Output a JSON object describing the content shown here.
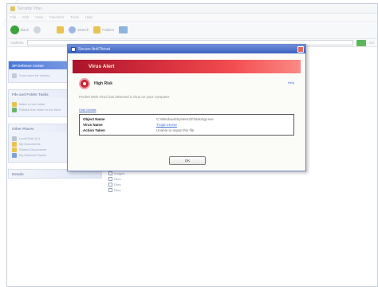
{
  "explorer": {
    "title": "Security Virus",
    "menu": [
      "File",
      "Edit",
      "View",
      "Favorites",
      "Tools",
      "Help"
    ],
    "toolbar": {
      "back": "Back",
      "search": "Search",
      "folders": "Folders"
    },
    "address_label": "Address",
    "go_label": "Go"
  },
  "sidebar": {
    "panels": [
      {
        "title": "XP Defence Center",
        "items": [
          "Scan drive for viruses"
        ]
      },
      {
        "title": "File and Folder Tasks",
        "items": [
          "Make a new folder",
          "Publish this folder to the Web"
        ]
      },
      {
        "title": "Other Places",
        "items": [
          "Local Disk (C:)",
          "My Documents",
          "Shared Documents",
          "My Network Places"
        ]
      },
      {
        "title": "Details",
        "items": []
      }
    ]
  },
  "files": [
    "Images",
    "Files",
    "Files",
    "Files"
  ],
  "dialog": {
    "window_title": "Secure AntiThreat",
    "banner": "Virus Alert",
    "help": "Help",
    "risk": "High Risk",
    "message": "Pocket Web Virus has detected a virus on your computer",
    "details_link": "Hide Details",
    "details": [
      {
        "key": "Object Name",
        "value": "C:\\Windows\\System32\\Taskmgr.exe",
        "link": false
      },
      {
        "key": "Virus Name",
        "value": "Trojan.Horse",
        "link": true
      },
      {
        "key": "Action Taken",
        "value": "Unable to repair this file",
        "link": false
      }
    ],
    "ok_label": "OK"
  },
  "colors": {
    "dialog_titlebar": "#3e63bf",
    "alert_banner": "#d8303e",
    "link": "#4a6fd1"
  }
}
